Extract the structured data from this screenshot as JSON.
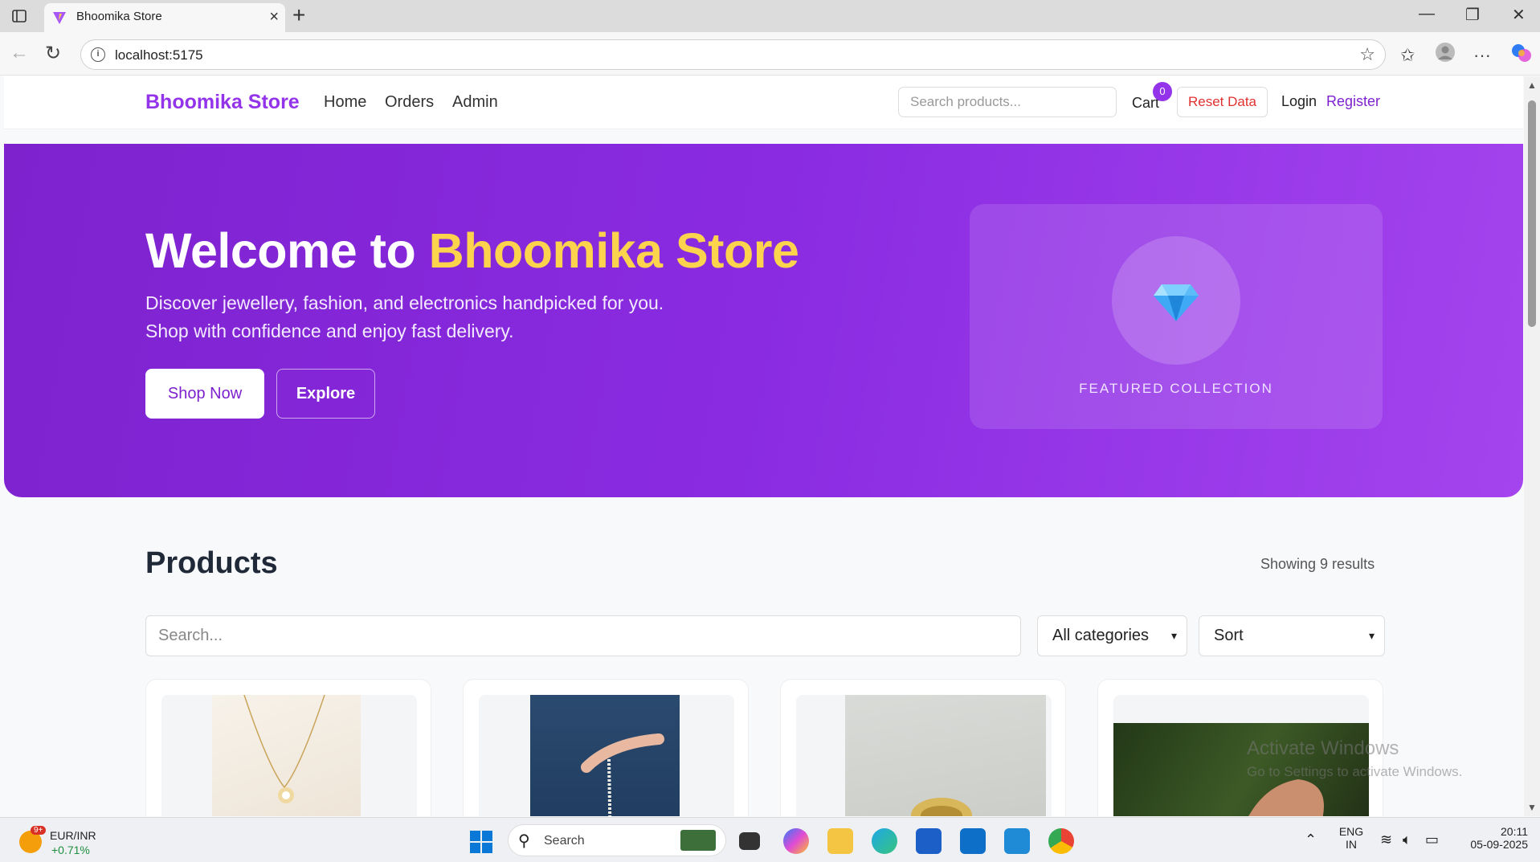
{
  "browser": {
    "tab_title": "Bhoomika Store",
    "url": "localhost:5175"
  },
  "header": {
    "brand": "Bhoomika Store",
    "nav": [
      "Home",
      "Orders",
      "Admin"
    ],
    "search_placeholder": "Search products...",
    "cart_label": "Cart",
    "cart_count": "0",
    "reset_label": "Reset Data",
    "login_label": "Login",
    "register_label": "Register"
  },
  "hero": {
    "title_prefix": "Welcome to ",
    "title_accent": "Bhoomika Store",
    "subtitle_line1": "Discover jewellery, fashion, and electronics handpicked for you.",
    "subtitle_line2": "Shop with confidence and enjoy fast delivery.",
    "primary_cta": "Shop Now",
    "secondary_cta": "Explore",
    "featured_label": "FEATURED COLLECTION",
    "featured_icon": "gem-icon"
  },
  "products": {
    "title": "Products",
    "results_text": "Showing 9 results",
    "search_placeholder": "Search...",
    "category_select": "All categories",
    "sort_select": "Sort"
  },
  "watermark": {
    "line1": "Activate Windows",
    "line2": "Go to Settings to activate Windows."
  },
  "taskbar": {
    "ticker_name": "EUR/INR",
    "ticker_change": "+0.71%",
    "ticker_badge": "9+",
    "search_label": "Search",
    "lang_top": "ENG",
    "lang_bottom": "IN",
    "time": "20:11",
    "date": "05-09-2025"
  },
  "colors": {
    "brand": "#9333ea",
    "accent_yellow": "#fcd34d",
    "reset_red": "#e03131"
  }
}
